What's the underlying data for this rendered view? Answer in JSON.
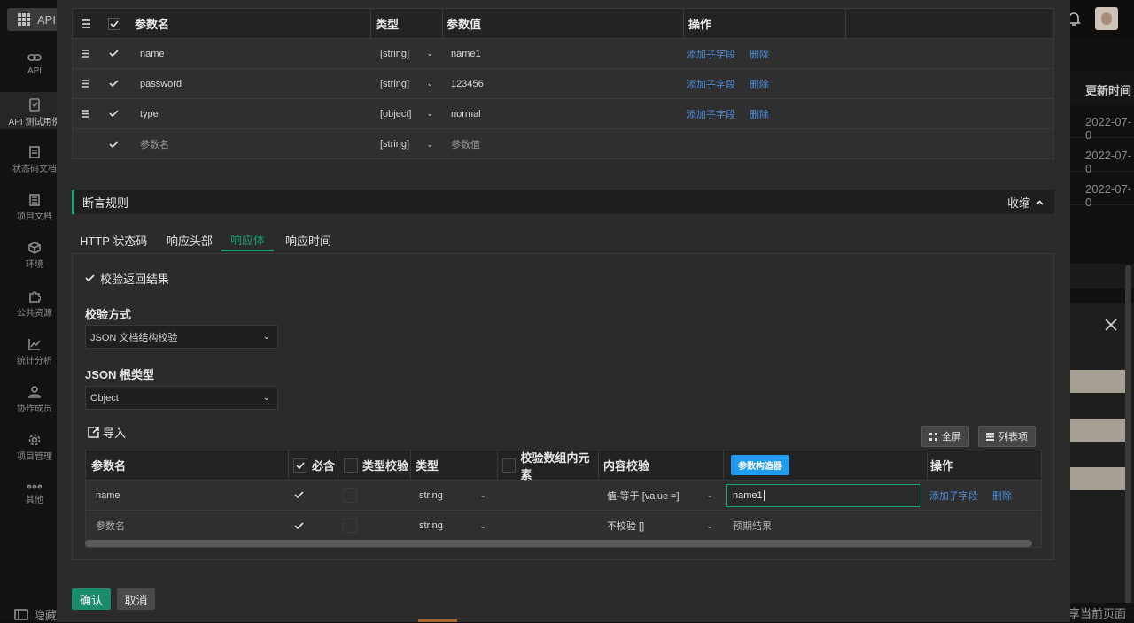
{
  "app": {
    "top_button": "API",
    "bottom_left": "隐藏",
    "bottom_right": "享当前页面"
  },
  "sidebar": {
    "items": [
      {
        "label": "API",
        "icon": "link-icon"
      },
      {
        "label": "API 测试用例",
        "icon": "clipboard-icon"
      },
      {
        "label": "状态码文档",
        "icon": "document-icon"
      },
      {
        "label": "项目文档",
        "icon": "book-icon"
      },
      {
        "label": "环境",
        "icon": "cube-icon"
      },
      {
        "label": "公共资源",
        "icon": "puzzle-icon"
      },
      {
        "label": "统计分析",
        "icon": "chart-icon"
      },
      {
        "label": "协作成员",
        "icon": "user-icon"
      },
      {
        "label": "项目管理",
        "icon": "gear-icon"
      },
      {
        "label": "其他",
        "icon": "more-icon"
      }
    ]
  },
  "background": {
    "column_header": "更新时间",
    "dates": [
      "2022-07-0",
      "2022-07-0",
      "2022-07-0"
    ]
  },
  "params_table": {
    "headers": {
      "name": "参数名",
      "type": "类型",
      "value": "参数值",
      "ops": "操作"
    },
    "rows": [
      {
        "name": "name",
        "type": "[string]",
        "value": "name1",
        "add": "添加子字段",
        "del": "删除"
      },
      {
        "name": "password",
        "type": "[string]",
        "value": "123456",
        "add": "添加子字段",
        "del": "删除"
      },
      {
        "name": "type",
        "type": "[object]",
        "value": "normal",
        "add": "添加子字段",
        "del": "删除"
      }
    ],
    "new_row": {
      "name": "参数名",
      "type": "[string]",
      "value": "参数值"
    }
  },
  "assert_section": {
    "title": "断言规则",
    "collapse": "收缩",
    "tabs": [
      "HTTP 状态码",
      "响应头部",
      "响应体",
      "响应时间"
    ],
    "active_tab": 2,
    "verify_result": "校验返回结果",
    "method_label": "校验方式",
    "method_value": "JSON 文档结构校验",
    "root_label": "JSON 根类型",
    "root_value": "Object",
    "import": "导入",
    "fullscreen": "全屏",
    "list_items": "列表项",
    "table": {
      "headers": {
        "name": "参数名",
        "required": "必含",
        "type_check": "类型校验",
        "type": "类型",
        "array_check": "校验数组内元素",
        "content_check": "内容校验",
        "ops": "操作"
      },
      "tooltip": "参数构造器",
      "rows": [
        {
          "name": "name",
          "type": "string",
          "check": "值-等于 [value =]",
          "value": "name1",
          "add": "添加子字段",
          "del": "删除"
        },
        {
          "name": "参数名",
          "type": "string",
          "check": "不校验 []",
          "value": "预期结果"
        }
      ]
    }
  },
  "footer": {
    "confirm": "确认",
    "cancel": "取消"
  }
}
